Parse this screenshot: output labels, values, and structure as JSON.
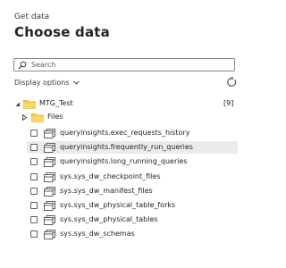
{
  "header": {
    "subtitle": "Get data",
    "title": "Choose data"
  },
  "search": {
    "placeholder": "Search"
  },
  "display_options": {
    "label": "Display options"
  },
  "tree": {
    "root": {
      "label": "MTG_Test",
      "count": "[9]",
      "expanded": true
    },
    "files_folder": {
      "label": "Files",
      "expanded": false
    },
    "tables": [
      {
        "label": "queryinsights.exec_requests_history",
        "checked": false,
        "selected": false
      },
      {
        "label": "queryinsights.frequently_run_queries",
        "checked": false,
        "selected": true
      },
      {
        "label": "queryinsights.long_running_queries",
        "checked": false,
        "selected": false
      },
      {
        "label": "sys.sys_dw_checkpoint_files",
        "checked": false,
        "selected": false
      },
      {
        "label": "sys.sys_dw_manifest_files",
        "checked": false,
        "selected": false
      },
      {
        "label": "sys.sys_dw_physical_table_forks",
        "checked": false,
        "selected": false
      },
      {
        "label": "sys.sys_dw_physical_tables",
        "checked": false,
        "selected": false
      },
      {
        "label": "sys.sys_dw_schemas",
        "checked": false,
        "selected": false
      }
    ]
  },
  "colors": {
    "folder": "#f2c94c",
    "folder_dark": "#e0b23a",
    "selected_row": "#edebe9",
    "text": "#252423"
  }
}
